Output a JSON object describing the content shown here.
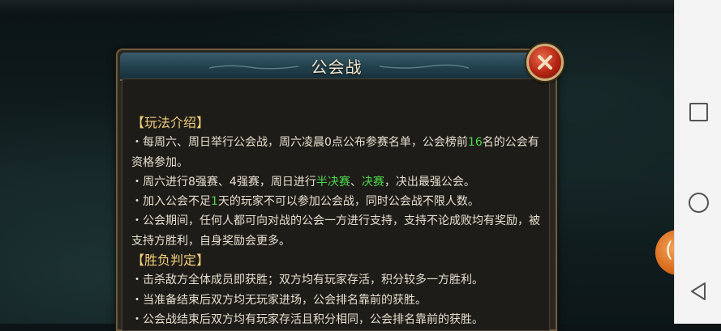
{
  "dialog": {
    "title": "公会战"
  },
  "sections": {
    "intro_heading": "【玩法介绍】",
    "r1": {
      "a": "・每周六、周日举行公会战，周六凌晨0点公布参赛名单，公会榜前",
      "num": "16",
      "b": "名的公会有资格参加。"
    },
    "r2": {
      "a": "・周六进行8强赛、4强赛，周日进行",
      "semi": "半决赛",
      "sep": "、",
      "final": "决赛",
      "b": "，决出最强公会。"
    },
    "r3": {
      "a": "・加入公会不足",
      "num": "1",
      "b": "天的玩家不可以参加公会战，同时公会战不限人数。"
    },
    "r4": "・公会期间，任何人都可向对战的公会一方进行支持，支持不论成败均有奖励，被支持方胜利，自身奖励会更多。",
    "result_heading": "【胜负判定】",
    "r5": "・击杀敌方全体成员即获胜；双方均有玩家存活，积分较多一方胜利。",
    "r6": "・当准备结束后双方均无玩家进场，公会排名靠前的获胜。",
    "r7": "・公会战结束后双方均有玩家存活且积分相同，公会排名靠前的获胜。"
  },
  "colors": {
    "highlight": "#4cd84c",
    "heading": "#f0cf7a",
    "body_text": "#e6dfcf",
    "close_button": "#b42512"
  },
  "icons": {
    "close": "close-x-icon",
    "nav_recents": "square-icon",
    "nav_home": "circle-icon",
    "nav_back": "triangle-back-icon"
  }
}
